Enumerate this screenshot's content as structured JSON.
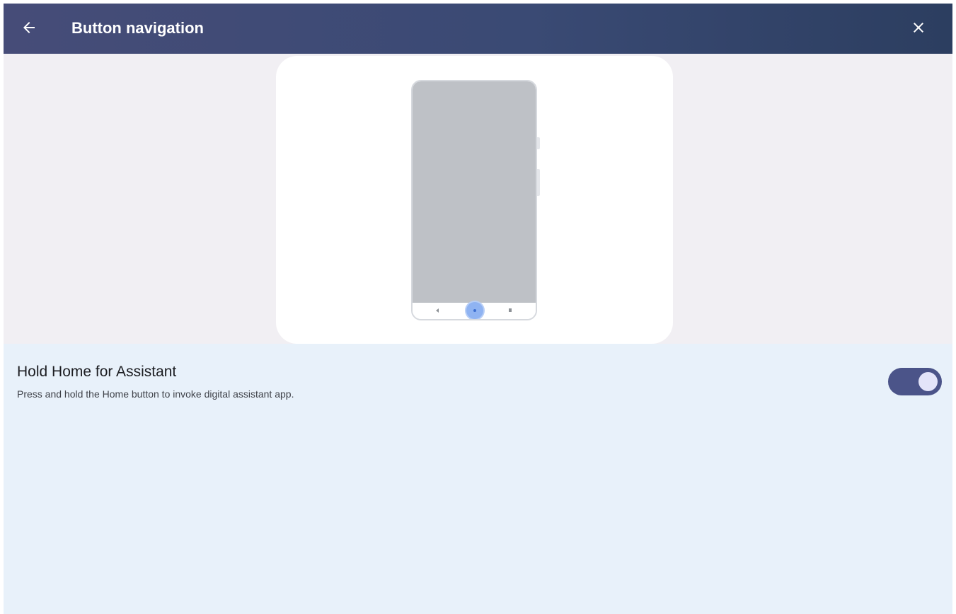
{
  "app_bar": {
    "title": "Button navigation",
    "back_icon": "arrow-back-icon",
    "close_icon": "close-icon",
    "background": "#3d4a74",
    "text_color": "#ffffff"
  },
  "illustration": {
    "description_icon": "phone-illustration",
    "home_button_highlight": "#8fb3f2",
    "phone_screen_color": "#bec1c6"
  },
  "setting": {
    "title": "Hold Home for Assistant",
    "summary": "Press and hold the Home button to invoke digital assistant app.",
    "toggle_on": true,
    "toggle_track_color": "#4b5489",
    "toggle_thumb_color": "#e3e4f9"
  },
  "colors": {
    "page_background": "#e8f1fa",
    "illustration_band": "#f1eff3",
    "card": "#ffffff"
  }
}
